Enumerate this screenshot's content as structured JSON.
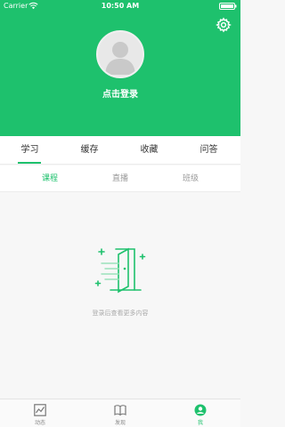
{
  "status_bar": {
    "carrier": "Carrier",
    "time": "10:50 AM"
  },
  "profile": {
    "login_label": "点击登录"
  },
  "tabs": [
    {
      "label": "学习",
      "active": true
    },
    {
      "label": "缓存",
      "active": false
    },
    {
      "label": "收藏",
      "active": false
    },
    {
      "label": "问答",
      "active": false
    }
  ],
  "subtabs": [
    {
      "label": "课程",
      "active": true
    },
    {
      "label": "直播",
      "active": false
    },
    {
      "label": "班级",
      "active": false
    }
  ],
  "empty_state": {
    "message": "登录后查看更多内容"
  },
  "bottom_nav": [
    {
      "label": "动态",
      "icon": "chart-icon",
      "active": false
    },
    {
      "label": "发现",
      "icon": "book-icon",
      "active": false
    },
    {
      "label": "我",
      "icon": "user-icon",
      "active": true
    }
  ],
  "colors": {
    "accent": "#1ec16d",
    "background": "#f7f7f7"
  }
}
